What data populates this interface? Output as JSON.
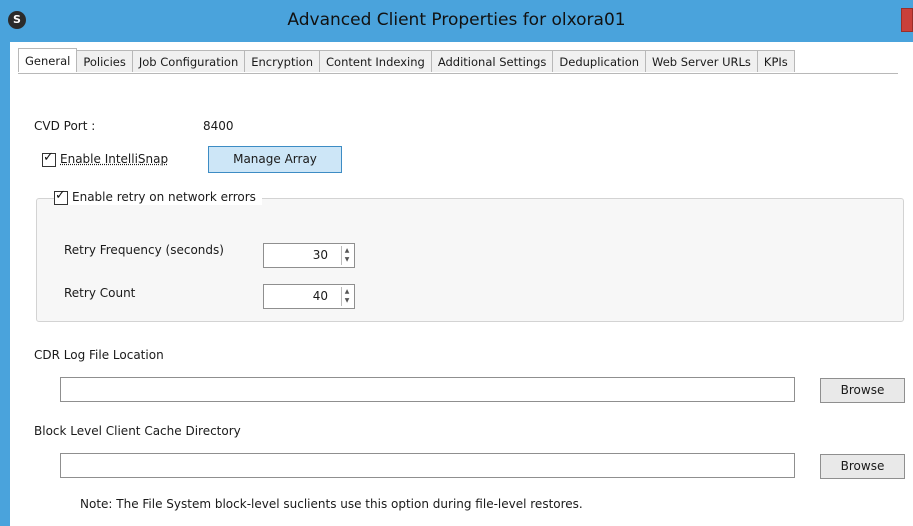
{
  "window": {
    "title": "Advanced Client Properties for olxora01",
    "app_icon": "commvault-logo-icon",
    "accent_color": "#4aa3dc"
  },
  "tabs": [
    {
      "label": "General",
      "active": true
    },
    {
      "label": "Policies",
      "active": false
    },
    {
      "label": "Job Configuration",
      "active": false
    },
    {
      "label": "Encryption",
      "active": false
    },
    {
      "label": "Content Indexing",
      "active": false
    },
    {
      "label": "Additional Settings",
      "active": false
    },
    {
      "label": "Deduplication",
      "active": false
    },
    {
      "label": "Web Server URLs",
      "active": false
    },
    {
      "label": "KPIs",
      "active": false
    }
  ],
  "general": {
    "cvd_port_label": "CVD Port :",
    "cvd_port_value": "8400",
    "intellisnap_label": "Enable IntelliSnap",
    "intellisnap_checked": true,
    "manage_array_label": "Manage Array",
    "retry_label": "Enable retry on network errors",
    "retry_checked": true,
    "retry_frequency_label": "Retry Frequency (seconds)",
    "retry_frequency_value": "30",
    "retry_count_label": "Retry Count",
    "retry_count_value": "40",
    "cdr_log_label": "CDR Log File Location",
    "cdr_log_value": "",
    "browse_label": "Browse",
    "block_cache_label": "Block Level Client Cache Directory",
    "block_cache_value": "",
    "note": "Note: The File System block-level suclients use this option during file-level restores."
  }
}
